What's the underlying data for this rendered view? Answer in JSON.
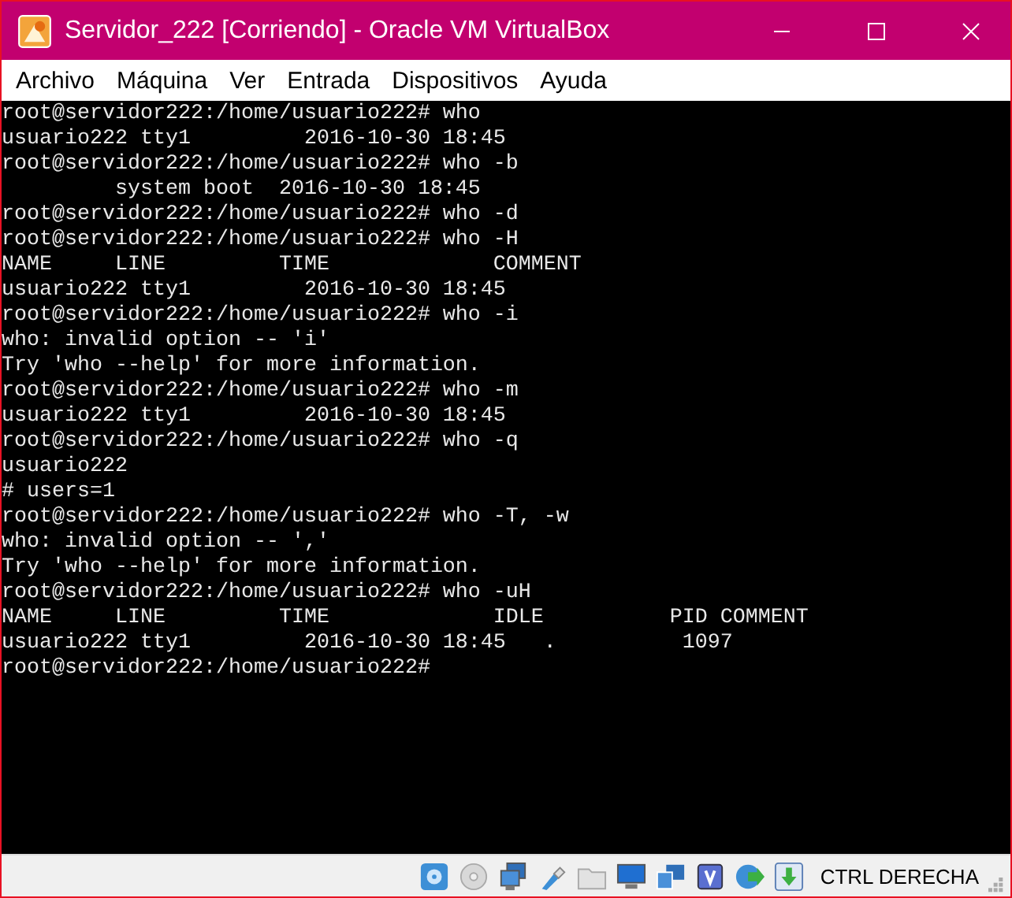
{
  "window": {
    "title": "Servidor_222 [Corriendo] - Oracle VM VirtualBox"
  },
  "menu": [
    "Archivo",
    "Máquina",
    "Ver",
    "Entrada",
    "Dispositivos",
    "Ayuda"
  ],
  "terminal": {
    "lines": [
      "root@servidor222:/home/usuario222# who",
      "usuario222 tty1         2016-10-30 18:45",
      "root@servidor222:/home/usuario222# who -b",
      "         system boot  2016-10-30 18:45",
      "root@servidor222:/home/usuario222# who -d",
      "root@servidor222:/home/usuario222# who -H",
      "NAME     LINE         TIME             COMMENT",
      "usuario222 tty1         2016-10-30 18:45",
      "root@servidor222:/home/usuario222# who -i",
      "who: invalid option -- 'i'",
      "Try 'who --help' for more information.",
      "root@servidor222:/home/usuario222# who -m",
      "usuario222 tty1         2016-10-30 18:45",
      "root@servidor222:/home/usuario222# who -q",
      "usuario222",
      "# users=1",
      "root@servidor222:/home/usuario222# who -T, -w",
      "who: invalid option -- ','",
      "Try 'who --help' for more information.",
      "root@servidor222:/home/usuario222# who -uH",
      "NAME     LINE         TIME             IDLE          PID COMMENT",
      "usuario222 tty1         2016-10-30 18:45   .          1097",
      "root@servidor222:/home/usuario222#"
    ]
  },
  "status_bar": {
    "host_key": "CTRL DERECHA"
  }
}
